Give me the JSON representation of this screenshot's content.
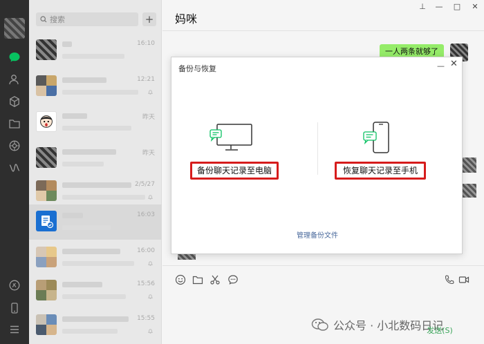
{
  "sidebar": {
    "icons": [
      "chat-icon",
      "contacts-icon",
      "favorites-icon",
      "files-icon",
      "moments-icon",
      "mini-program-icon",
      "channel-icon",
      "phone-icon",
      "menu-icon"
    ]
  },
  "chat_list": {
    "search_placeholder": "搜索",
    "add_label": "+",
    "items": [
      {
        "time": "16:10",
        "muted": false
      },
      {
        "time": "12:21",
        "muted": true
      },
      {
        "time": "昨天",
        "muted": false
      },
      {
        "time": "昨天",
        "muted": false
      },
      {
        "time": "2/5/27",
        "muted": true
      },
      {
        "time": "16:03",
        "muted": false
      },
      {
        "time": "16:00",
        "muted": true
      },
      {
        "time": "15:56",
        "muted": true
      },
      {
        "time": "15:55",
        "muted": true
      }
    ]
  },
  "chat": {
    "title": "妈咪",
    "my_message": "一人两条就够了",
    "send_label": "发送(S)"
  },
  "window_controls": {
    "pin": "⊥",
    "minimize": "—",
    "maximize": "□",
    "close": "✕"
  },
  "backup_dialog": {
    "title": "备份与恢复",
    "minimize": "—",
    "close": "✕",
    "backup_to_pc": "备份聊天记录至电脑",
    "restore_to_phone": "恢复聊天记录至手机",
    "manage_files": "管理备份文件"
  },
  "watermark": {
    "text": "公众号 · 小北数码日记"
  },
  "colors": {
    "rail": "#2e2e2e",
    "active_green": "#07c160",
    "bubble": "#95ec69",
    "highlight_red": "#d61c1c",
    "link_blue": "#4a6a9c"
  }
}
